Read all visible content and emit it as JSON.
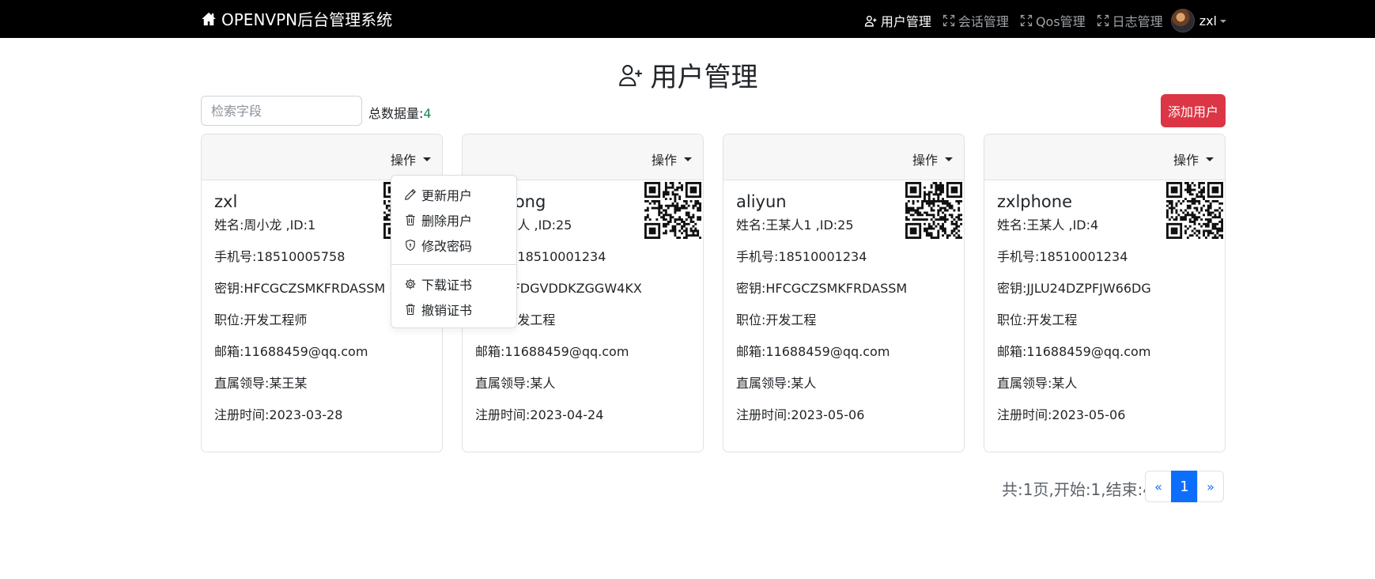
{
  "navbar": {
    "brand": "OPENVPN后台管理系统",
    "items": [
      {
        "label": "用户管理",
        "icon": "person-plus-icon",
        "active": true
      },
      {
        "label": "会话管理",
        "icon": "fullscreen-icon",
        "active": false
      },
      {
        "label": "Qos管理",
        "icon": "fullscreen-icon",
        "active": false
      },
      {
        "label": "日志管理",
        "icon": "fullscreen-icon",
        "active": false
      }
    ],
    "user": "zxl"
  },
  "page": {
    "title": "用户管理"
  },
  "toolbar": {
    "search_placeholder": "检索字段",
    "total_label": "总数据量:",
    "total_count": "4",
    "add_user_label": "添加用户"
  },
  "cards": [
    {
      "op_label": "操作",
      "username": "zxl",
      "name_line": "姓名:周小龙 ,ID:1",
      "phone": "手机号:18510005758",
      "secret": "密钥:HFCGCZSMKFRDASSM",
      "position": "职位:开发工程师",
      "email": "邮箱:11688459@qq.com",
      "leader": "直属领导:某王某",
      "registered": "注册时间:2023-03-28"
    },
    {
      "op_label": "操作",
      "username": "xiaolong",
      "name_line": "姓名:某人 ,ID:25",
      "phone": "手机号:18510001234",
      "secret": "密钥:3FDGVDDKZGGW4KX",
      "position": "职位:开发工程",
      "email": "邮箱:11688459@qq.com",
      "leader": "直属领导:某人",
      "registered": "注册时间:2023-04-24"
    },
    {
      "op_label": "操作",
      "username": "aliyun",
      "name_line": "姓名:王某人1 ,ID:25",
      "phone": "手机号:18510001234",
      "secret": "密钥:HFCGCZSMKFRDASSM",
      "position": "职位:开发工程",
      "email": "邮箱:11688459@qq.com",
      "leader": "直属领导:某人",
      "registered": "注册时间:2023-05-06"
    },
    {
      "op_label": "操作",
      "username": "zxlphone",
      "name_line": "姓名:王某人 ,ID:4",
      "phone": "手机号:18510001234",
      "secret": "密钥:JJLU24DZPFJW66DG",
      "position": "职位:开发工程",
      "email": "邮箱:11688459@qq.com",
      "leader": "直属领导:某人",
      "registered": "注册时间:2023-05-06"
    }
  ],
  "dropdown": {
    "items": [
      {
        "label": "更新用户",
        "icon": "pencil-icon"
      },
      {
        "label": "删除用户",
        "icon": "trash-icon"
      },
      {
        "label": "修改密码",
        "icon": "shield-icon"
      },
      {
        "label": "下载证书",
        "icon": "gear-icon"
      },
      {
        "label": "撤销证书",
        "icon": "trash-icon"
      }
    ]
  },
  "pagination": {
    "info": "共:1页,开始:1,结束:4",
    "prev": "«",
    "current": "1",
    "next": "»"
  },
  "colors": {
    "navbar_bg": "#000000",
    "danger": "#dc3545",
    "primary": "#0d6efd",
    "success": "#198754"
  }
}
